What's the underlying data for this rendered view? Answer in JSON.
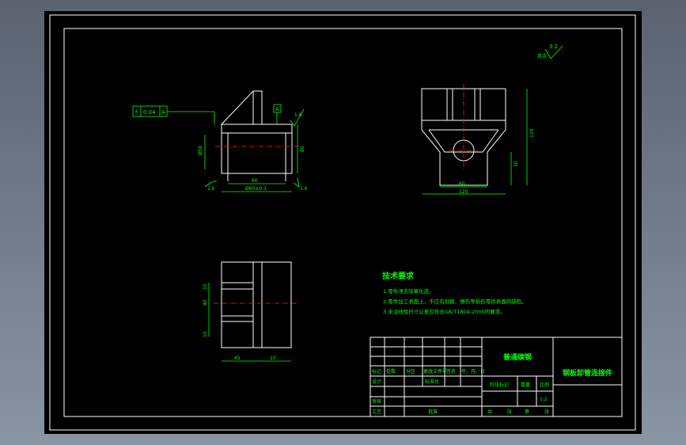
{
  "roughness": {
    "symbol_value": "3.2",
    "label": "其余"
  },
  "front_view": {
    "tolerance_frame": [
      "f",
      "0.04",
      "A"
    ],
    "datum": "A",
    "roughness_right_top": "1.6",
    "roughness_left": "1.6",
    "roughness_right_bottom": "1.6",
    "dim_left": "Ø50",
    "dim_right": "80",
    "dim_bottom_inner": "60",
    "dim_bottom_outer": "Ø60±0.1"
  },
  "side_view": {
    "dim_height": "120",
    "dim_lower": "30",
    "dim_inner_width": "60",
    "dim_outer_width": "120"
  },
  "top_view": {
    "dim_v1": "10",
    "dim_v2": "40",
    "dim_v3": "10",
    "dim_h1": "45",
    "dim_h2": "10"
  },
  "tech_requirements": {
    "title": "技术要求",
    "items": [
      "1.零件须去除氧化皮。",
      "2.零件加工表面上，不应有划痕、擦伤等损伤零件表面的缺陷。",
      "3.未注线性尺寸公差应符合GB/T1804-2000的要求。"
    ]
  },
  "title_block": {
    "material": "普通碳钢",
    "part_name": "钢板卸管连接件",
    "row_headers": [
      "标记",
      "处数",
      "分区",
      "更改文件号",
      "签名",
      "年、月、日"
    ],
    "label_design": "设计",
    "label_standardize": "标准化",
    "label_review": "审核",
    "label_process": "工艺",
    "label_approve": "批准",
    "label_stage": "阶段标记",
    "label_weight": "重量",
    "label_scale": "比例",
    "scale_value": "1:2",
    "sheet_info": [
      "共",
      "张",
      "第",
      "张"
    ]
  }
}
